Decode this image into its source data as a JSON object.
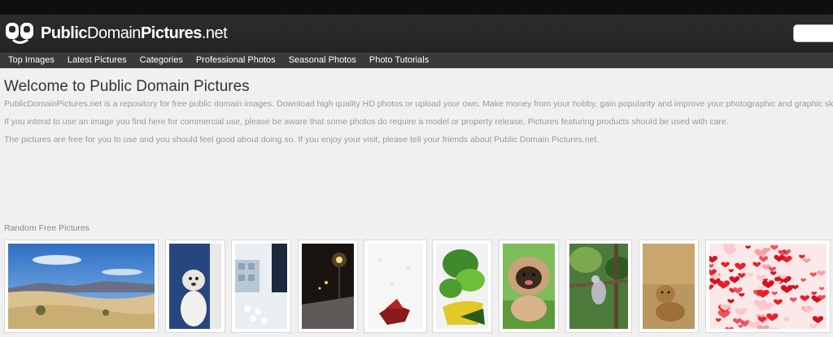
{
  "site": {
    "logo_bold_1": "Public",
    "logo_light": "Domain",
    "logo_bold_2": "Pictures",
    "logo_tld": ".net"
  },
  "nav": {
    "items": [
      "Top Images",
      "Latest Pictures",
      "Categories",
      "Professional Photos",
      "Seasonal Photos",
      "Photo Tutorials"
    ]
  },
  "main": {
    "title": "Welcome to Public Domain Pictures",
    "paragraphs": [
      "PublicDomainPictures.net is a repository for free public domain images. Download high quality HD photos or upload your own. Make money from your hobby, gain popularity and improve your photographic and graphic skills.",
      "If you intend to use an image you find here for commercial use, please be aware that some photos do require a model or property release. Pictures featuring products should be used with care.",
      "The pictures are free for you to use and you should feel good about doing so. If you enjoy your visit, please tell your friends about Public Domain Pictures.net."
    ]
  },
  "random": {
    "label": "Random Free Pictures",
    "thumbs": [
      {
        "subject": "desert-dunes"
      },
      {
        "subject": "dog-sitting"
      },
      {
        "subject": "lab-dough"
      },
      {
        "subject": "street-lamp-night"
      },
      {
        "subject": "poinsettia-snow"
      },
      {
        "subject": "green-leaves-cup"
      },
      {
        "subject": "pekingese-dog"
      },
      {
        "subject": "bird-branch"
      },
      {
        "subject": "lion-cub"
      },
      {
        "subject": "hearts-pattern"
      }
    ]
  },
  "colors": {
    "header_bg": "#2a2a2a",
    "nav_bg": "#3a3a3a",
    "page_bg": "#f0f0f0",
    "title_text": "#333333",
    "body_text": "#999999"
  }
}
